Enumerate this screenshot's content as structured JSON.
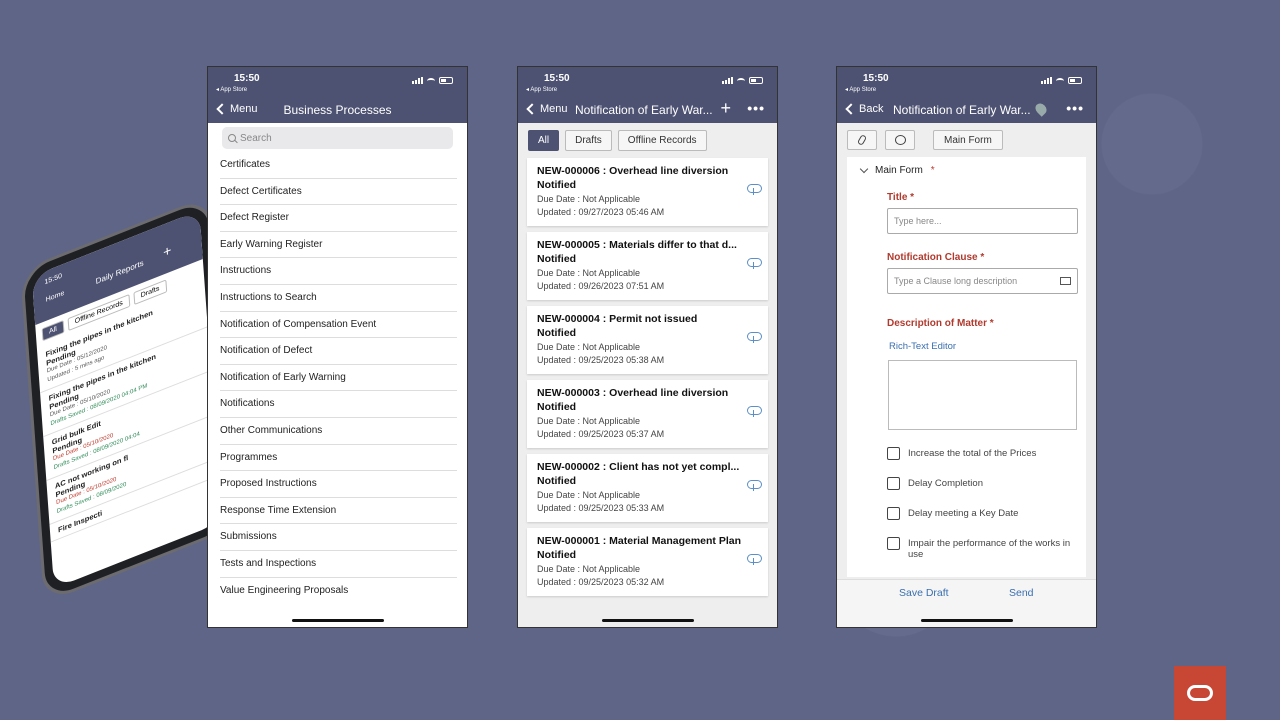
{
  "status": {
    "time": "15:50",
    "back_app": "◂ App Store"
  },
  "screen1": {
    "back_label": "Menu",
    "title": "Business Processes",
    "search_placeholder": "Search",
    "items": [
      "Certificates",
      "Defect Certificates",
      "Defect Register",
      "Early Warning Register",
      "Instructions",
      "Instructions to Search",
      "Notification of Compensation Event",
      "Notification of Defect",
      "Notification of Early Warning",
      "Notifications",
      "Other Communications",
      "Programmes",
      "Proposed Instructions",
      "Response Time Extension",
      "Submissions",
      "Tests and Inspections",
      "Value Engineering Proposals"
    ]
  },
  "screen2": {
    "back_label": "Menu",
    "title": "Notification of Early War...",
    "filters": [
      "All",
      "Drafts",
      "Offline Records"
    ],
    "active_filter": "All",
    "cards": [
      {
        "title": "NEW-000006 : Overhead line diversion",
        "status": "Notified",
        "due": "Due Date : Not Applicable",
        "updated": "Updated : 09/27/2023 05:46 AM"
      },
      {
        "title": "NEW-000005 : Materials differ to that d...",
        "status": "Notified",
        "due": "Due Date : Not Applicable",
        "updated": "Updated : 09/26/2023 07:51 AM"
      },
      {
        "title": "NEW-000004 : Permit not issued",
        "status": "Notified",
        "due": "Due Date : Not Applicable",
        "updated": "Updated : 09/25/2023 05:38 AM"
      },
      {
        "title": "NEW-000003 : Overhead line diversion",
        "status": "Notified",
        "due": "Due Date : Not Applicable",
        "updated": "Updated : 09/25/2023 05:37 AM"
      },
      {
        "title": "NEW-000002 : Client has not yet compl...",
        "status": "Notified",
        "due": "Due Date : Not Applicable",
        "updated": "Updated : 09/25/2023 05:33 AM"
      },
      {
        "title": "NEW-000001 : Material Management Plan",
        "status": "Notified",
        "due": "Due Date : Not Applicable",
        "updated": "Updated : 09/25/2023 05:32 AM"
      }
    ]
  },
  "screen3": {
    "back_label": "Back",
    "title": "Notification of Early War...",
    "main_form_btn": "Main Form",
    "section": "Main Form",
    "title_label": "Title",
    "title_placeholder": "Type here...",
    "clause_label": "Notification Clause",
    "clause_placeholder": "Type a Clause long description",
    "desc_label": "Description of Matter",
    "rte_link": "Rich-Text Editor",
    "checkboxes": [
      "Increase the total of the Prices",
      "Delay Completion",
      "Delay meeting a Key Date",
      "Impair the performance of the works in use"
    ],
    "save_draft": "Save Draft",
    "send": "Send"
  },
  "mini_phone": {
    "back": "Home",
    "title": "Daily Reports",
    "tabs": [
      "All",
      "Offline Records",
      "Drafts"
    ],
    "items": [
      {
        "title": "Fixing the pipes in the kitchen",
        "status": "Pending",
        "due": "Due Date : 05/12/2020",
        "extra": "Updated : 5 mins ago"
      },
      {
        "title": "Fixing the pipes in the kitchen",
        "status": "Pending",
        "due": "Due Date : 05/10/2020",
        "extra": "Drafts Saved : 08/09/2020 04:04 PM"
      },
      {
        "title": "Grid bulk Edit",
        "status": "Pending",
        "due": "Due Date : 05/10/2020",
        "extra": "Drafts Saved : 08/09/2020 04:04"
      },
      {
        "title": "AC not working on fl",
        "status": "Pending",
        "due": "Due Date : 05/10/2020",
        "extra": "Drafts Saved : 08/09/2020"
      },
      {
        "title": "Fire Inspecti",
        "status": "",
        "due": "",
        "extra": ""
      }
    ]
  },
  "colors": {
    "nav": "#4d5272",
    "bg": "#5f6587",
    "brand": "#c74634",
    "link": "#3a6fb0",
    "required": "#c0392b"
  }
}
